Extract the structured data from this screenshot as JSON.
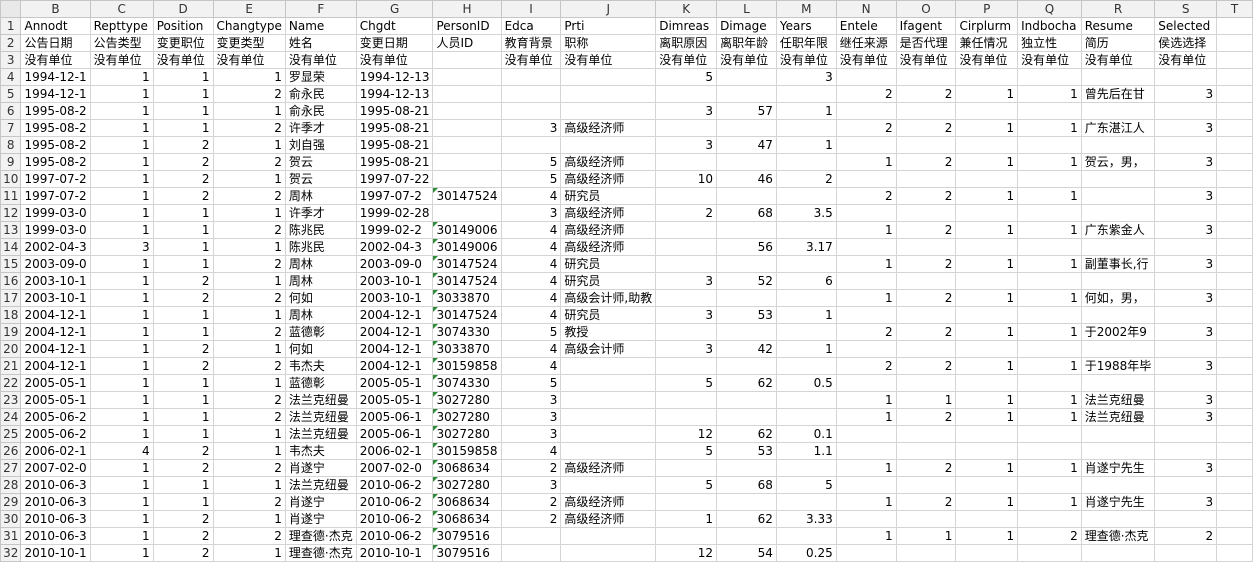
{
  "columns": [
    "B",
    "C",
    "D",
    "E",
    "F",
    "G",
    "H",
    "I",
    "J",
    "K",
    "L",
    "M",
    "N",
    "O",
    "P",
    "Q",
    "R",
    "S",
    "T"
  ],
  "num_cols": [
    "B",
    "C",
    "D",
    "E",
    "I",
    "K",
    "L",
    "M",
    "N",
    "O",
    "P",
    "Q",
    "S"
  ],
  "rows": [
    {
      "n": "1",
      "c": {
        "B": "Annodt",
        "C": "Repttype",
        "D": "Position",
        "E": "Changtype",
        "F": "Name",
        "G": "Chgdt",
        "H": "PersonID",
        "I": "Edca",
        "J": "Prti",
        "K": "Dimreas",
        "L": "Dimage",
        "M": "Years",
        "N": "Entele",
        "O": "Ifagent",
        "P": "Cirplurm",
        "Q": "Indbocha",
        "R": "Resume",
        "S": "Selected"
      }
    },
    {
      "n": "2",
      "c": {
        "B": "公告日期",
        "C": "公告类型",
        "D": "变更职位",
        "E": "变更类型",
        "F": "姓名",
        "G": "变更日期",
        "H": "人员ID",
        "I": "教育背景",
        "J": "职称",
        "K": "离职原因",
        "L": "离职年龄",
        "M": "任职年限",
        "N": "继任来源",
        "O": "是否代理",
        "P": "兼任情况",
        "Q": "独立性",
        "R": "简历",
        "S": "侯选选择"
      }
    },
    {
      "n": "3",
      "c": {
        "B": "没有单位",
        "C": "没有单位",
        "D": "没有单位",
        "E": "没有单位",
        "F": "没有单位",
        "G": "没有单位",
        "I": "没有单位",
        "J": "没有单位",
        "K": "没有单位",
        "L": "没有单位",
        "M": "没有单位",
        "N": "没有单位",
        "O": "没有单位",
        "P": "没有单位",
        "Q": "没有单位",
        "R": "没有单位",
        "S": "没有单位"
      }
    },
    {
      "n": "4",
      "c": {
        "B": "1994-12-1",
        "C": "1",
        "D": "1",
        "E": "1",
        "F": "罗显荣",
        "G": "1994-12-13",
        "K": "5",
        "M": "3"
      }
    },
    {
      "n": "5",
      "c": {
        "B": "1994-12-1",
        "C": "1",
        "D": "1",
        "E": "2",
        "F": "俞永民",
        "G": "1994-12-13",
        "N": "2",
        "O": "2",
        "P": "1",
        "Q": "1",
        "R": "曾先后在甘",
        "S": "3"
      }
    },
    {
      "n": "6",
      "c": {
        "B": "1995-08-2",
        "C": "1",
        "D": "1",
        "E": "1",
        "F": "俞永民",
        "G": "1995-08-21",
        "K": "3",
        "L": "57",
        "M": "1"
      }
    },
    {
      "n": "7",
      "c": {
        "B": "1995-08-2",
        "C": "1",
        "D": "1",
        "E": "2",
        "F": "许季才",
        "G": "1995-08-21",
        "I": "3",
        "J": "高级经济师",
        "N": "2",
        "O": "2",
        "P": "1",
        "Q": "1",
        "R": "广东湛江人",
        "S": "3"
      }
    },
    {
      "n": "8",
      "c": {
        "B": "1995-08-2",
        "C": "1",
        "D": "2",
        "E": "1",
        "F": "刘自强",
        "G": "1995-08-21",
        "K": "3",
        "L": "47",
        "M": "1"
      }
    },
    {
      "n": "9",
      "c": {
        "B": "1995-08-2",
        "C": "1",
        "D": "2",
        "E": "2",
        "F": "贺云",
        "G": "1995-08-21",
        "I": "5",
        "J": "高级经济师",
        "N": "1",
        "O": "2",
        "P": "1",
        "Q": "1",
        "R": "贺云，男，",
        "S": "3"
      }
    },
    {
      "n": "10",
      "c": {
        "B": "1997-07-2",
        "C": "1",
        "D": "2",
        "E": "1",
        "F": "贺云",
        "G": "1997-07-22",
        "I": "5",
        "J": "高级经济师",
        "K": "10",
        "L": "46",
        "M": "2"
      }
    },
    {
      "n": "11",
      "c": {
        "B": "1997-07-2",
        "C": "1",
        "D": "2",
        "E": "2",
        "F": "周林",
        "G": "1997-07-2",
        "H": "30147524",
        "I": "4",
        "J": "研究员",
        "N": "2",
        "O": "2",
        "P": "1",
        "Q": "1",
        "S": "3"
      }
    },
    {
      "n": "12",
      "c": {
        "B": "1999-03-0",
        "C": "1",
        "D": "1",
        "E": "1",
        "F": "许季才",
        "G": "1999-02-28",
        "I": "3",
        "J": "高级经济师",
        "K": "2",
        "L": "68",
        "M": "3.5"
      }
    },
    {
      "n": "13",
      "c": {
        "B": "1999-03-0",
        "C": "1",
        "D": "1",
        "E": "2",
        "F": "陈兆民",
        "G": "1999-02-2",
        "H": "30149006",
        "I": "4",
        "J": "高级经济师",
        "N": "1",
        "O": "2",
        "P": "1",
        "Q": "1",
        "R": "广东紫金人",
        "S": "3"
      }
    },
    {
      "n": "14",
      "c": {
        "B": "2002-04-3",
        "C": "3",
        "D": "1",
        "E": "1",
        "F": "陈兆民",
        "G": "2002-04-3",
        "H": "30149006",
        "I": "4",
        "J": "高级经济师",
        "L": "56",
        "M": "3.17"
      }
    },
    {
      "n": "15",
      "c": {
        "B": "2003-09-0",
        "C": "1",
        "D": "1",
        "E": "2",
        "F": "周林",
        "G": "2003-09-0",
        "H": "30147524",
        "I": "4",
        "J": "研究员",
        "N": "1",
        "O": "2",
        "P": "1",
        "Q": "1",
        "R": "副董事长,行",
        "S": "3"
      }
    },
    {
      "n": "16",
      "c": {
        "B": "2003-10-1",
        "C": "1",
        "D": "2",
        "E": "1",
        "F": "周林",
        "G": "2003-10-1",
        "H": "30147524",
        "I": "4",
        "J": "研究员",
        "K": "3",
        "L": "52",
        "M": "6"
      }
    },
    {
      "n": "17",
      "c": {
        "B": "2003-10-1",
        "C": "1",
        "D": "2",
        "E": "2",
        "F": "何如",
        "G": "2003-10-1",
        "H": "3033870",
        "I": "4",
        "J": "高级会计师,助教",
        "N": "1",
        "O": "2",
        "P": "1",
        "Q": "1",
        "R": "何如，男，",
        "S": "3"
      }
    },
    {
      "n": "18",
      "c": {
        "B": "2004-12-1",
        "C": "1",
        "D": "1",
        "E": "1",
        "F": "周林",
        "G": "2004-12-1",
        "H": "30147524",
        "I": "4",
        "J": "研究员",
        "K": "3",
        "L": "53",
        "M": "1"
      }
    },
    {
      "n": "19",
      "c": {
        "B": "2004-12-1",
        "C": "1",
        "D": "1",
        "E": "2",
        "F": "蓝德彰",
        "G": "2004-12-1",
        "H": "3074330",
        "I": "5",
        "J": "教授",
        "N": "2",
        "O": "2",
        "P": "1",
        "Q": "1",
        "R": "于2002年9",
        "S": "3"
      }
    },
    {
      "n": "20",
      "c": {
        "B": "2004-12-1",
        "C": "1",
        "D": "2",
        "E": "1",
        "F": "何如",
        "G": "2004-12-1",
        "H": "3033870",
        "I": "4",
        "J": "高级会计师",
        "K": "3",
        "L": "42",
        "M": "1"
      }
    },
    {
      "n": "21",
      "c": {
        "B": "2004-12-1",
        "C": "1",
        "D": "2",
        "E": "2",
        "F": "韦杰夫",
        "G": "2004-12-1",
        "H": "30159858",
        "I": "4",
        "N": "2",
        "O": "2",
        "P": "1",
        "Q": "1",
        "R": "于1988年毕",
        "S": "3"
      }
    },
    {
      "n": "22",
      "c": {
        "B": "2005-05-1",
        "C": "1",
        "D": "1",
        "E": "1",
        "F": "蓝德彰",
        "G": "2005-05-1",
        "H": "3074330",
        "I": "5",
        "K": "5",
        "L": "62",
        "M": "0.5"
      }
    },
    {
      "n": "23",
      "c": {
        "B": "2005-05-1",
        "C": "1",
        "D": "1",
        "E": "2",
        "F": "法兰克纽曼",
        "G": "2005-05-1",
        "H": "3027280",
        "I": "3",
        "N": "1",
        "O": "1",
        "P": "1",
        "Q": "1",
        "R": "法兰克纽曼",
        "S": "3"
      }
    },
    {
      "n": "24",
      "c": {
        "B": "2005-06-2",
        "C": "1",
        "D": "1",
        "E": "2",
        "F": "法兰克纽曼",
        "G": "2005-06-1",
        "H": "3027280",
        "I": "3",
        "N": "1",
        "O": "2",
        "P": "1",
        "Q": "1",
        "R": "法兰克纽曼",
        "S": "3"
      }
    },
    {
      "n": "25",
      "c": {
        "B": "2005-06-2",
        "C": "1",
        "D": "1",
        "E": "1",
        "F": "法兰克纽曼",
        "G": "2005-06-1",
        "H": "3027280",
        "I": "3",
        "K": "12",
        "L": "62",
        "M": "0.1"
      }
    },
    {
      "n": "26",
      "c": {
        "B": "2006-02-1",
        "C": "4",
        "D": "2",
        "E": "1",
        "F": "韦杰夫",
        "G": "2006-02-1",
        "H": "30159858",
        "I": "4",
        "K": "5",
        "L": "53",
        "M": "1.1"
      }
    },
    {
      "n": "27",
      "c": {
        "B": "2007-02-0",
        "C": "1",
        "D": "2",
        "E": "2",
        "F": "肖遂宁",
        "G": "2007-02-0",
        "H": "3068634",
        "I": "2",
        "J": "高级经济师",
        "N": "1",
        "O": "2",
        "P": "1",
        "Q": "1",
        "R": "肖遂宁先生",
        "S": "3"
      }
    },
    {
      "n": "28",
      "c": {
        "B": "2010-06-3",
        "C": "1",
        "D": "1",
        "E": "1",
        "F": "法兰克纽曼",
        "G": "2010-06-2",
        "H": "3027280",
        "I": "3",
        "K": "5",
        "L": "68",
        "M": "5"
      }
    },
    {
      "n": "29",
      "c": {
        "B": "2010-06-3",
        "C": "1",
        "D": "1",
        "E": "2",
        "F": "肖遂宁",
        "G": "2010-06-2",
        "H": "3068634",
        "I": "2",
        "J": "高级经济师",
        "N": "1",
        "O": "2",
        "P": "1",
        "Q": "1",
        "R": "肖遂宁先生",
        "S": "3"
      }
    },
    {
      "n": "30",
      "c": {
        "B": "2010-06-3",
        "C": "1",
        "D": "2",
        "E": "1",
        "F": "肖遂宁",
        "G": "2010-06-2",
        "H": "3068634",
        "I": "2",
        "J": "高级经济师",
        "K": "1",
        "L": "62",
        "M": "3.33"
      }
    },
    {
      "n": "31",
      "c": {
        "B": "2010-06-3",
        "C": "1",
        "D": "2",
        "E": "2",
        "F": "理查德·杰克",
        "G": "2010-06-2",
        "H": "3079516",
        "N": "1",
        "O": "1",
        "P": "1",
        "Q": "2",
        "R": "理查德·杰克",
        "S": "2"
      }
    },
    {
      "n": "32",
      "c": {
        "B": "2010-10-1",
        "C": "1",
        "D": "2",
        "E": "1",
        "F": "理查德·杰克",
        "G": "2010-10-1",
        "H": "3079516",
        "K": "12",
        "L": "54",
        "M": "0.25"
      }
    }
  ]
}
